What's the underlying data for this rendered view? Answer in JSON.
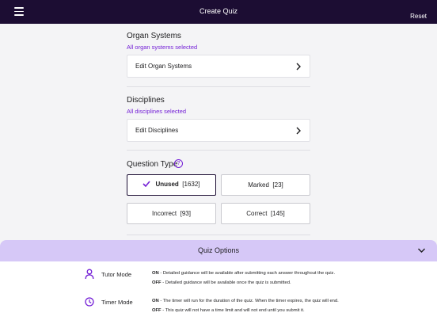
{
  "header": {
    "title": "Create Quiz",
    "reset_label": "Reset"
  },
  "organ_systems": {
    "title": "Organ Systems",
    "subtitle": "All organ systems selected",
    "edit_label": "Edit Organ Systems"
  },
  "disciplines": {
    "title": "Disciplines",
    "subtitle": "All disciplines selected",
    "edit_label": "Edit Disciplines"
  },
  "question_type": {
    "title": "Question Type",
    "help_glyph": "?",
    "options": [
      {
        "label": "Unused",
        "count": "[1632]",
        "selected": true
      },
      {
        "label": "Marked",
        "count": "[23]",
        "selected": false
      },
      {
        "label": "Incorrect",
        "count": "[93]",
        "selected": false
      },
      {
        "label": "Correct",
        "count": "[145]",
        "selected": false
      }
    ]
  },
  "quiz_options": {
    "title": "Quiz Options",
    "tutor_mode": {
      "label": "Tutor Mode",
      "icon": "person-icon",
      "on_key": "ON",
      "on_text": " - Detailed guidance will be available after submitting each answer throughout the quiz.",
      "off_key": "OFF",
      "off_text": " - Detailed guidance will be available once the quiz is submitted."
    },
    "timer_mode": {
      "label": "Timer Mode",
      "icon": "clock-icon",
      "on_key": "ON",
      "on_text": " - The timer will run for the duration of the quiz. When the timer expires, the quiz will end.",
      "off_key": "OFF",
      "off_text": " - This quiz will not have a time limit and will not end until you submit it."
    }
  },
  "colors": {
    "topbar": "#1c0d33",
    "accent": "#7420d6",
    "options_header": "#d6c8f7"
  }
}
